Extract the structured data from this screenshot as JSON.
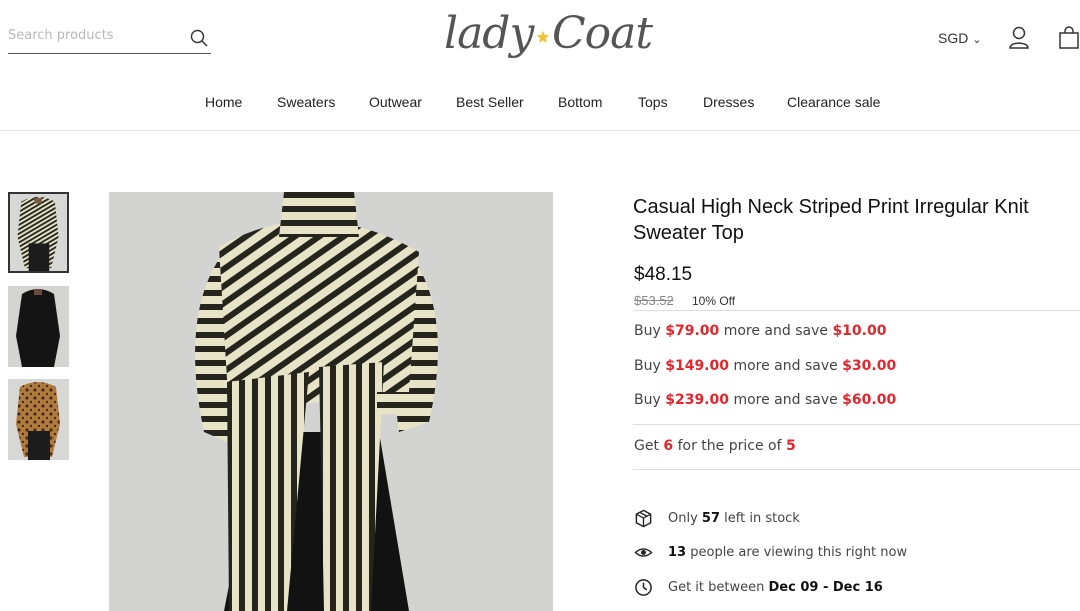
{
  "header": {
    "search": {
      "placeholder": "Search products",
      "value": ""
    },
    "logo": {
      "left": "lady",
      "right": "Coat"
    },
    "currency": "SGD",
    "icons": {
      "search": "search-icon",
      "account": "user-icon",
      "cart": "shopping-bag-icon"
    }
  },
  "nav": {
    "items": [
      "Home",
      "Sweaters",
      "Outwear",
      "Best Seller",
      "Bottom",
      "Tops",
      "Dresses",
      "Clearance sale"
    ]
  },
  "gallery": {
    "thumbnail_count": 3,
    "active_index": 0
  },
  "product": {
    "title": "Casual High Neck Striped Print Irregular Knit Sweater Top",
    "price": "$48.15",
    "compare_price": "$53.52",
    "discount": "10% Off",
    "promotions": [
      {
        "prefix": "Buy",
        "amount": "$79.00",
        "middle": "more and save",
        "save": "$10.00"
      },
      {
        "prefix": "Buy",
        "amount": "$149.00",
        "middle": "more and save",
        "save": "$30.00"
      },
      {
        "prefix": "Buy",
        "amount": "$239.00",
        "middle": "more and save",
        "save": "$60.00"
      }
    ],
    "bundle": {
      "prefix": "Get",
      "get": "6",
      "middle": "for the price of",
      "pay": "5"
    },
    "stock": {
      "prefix": "Only",
      "count": "57",
      "suffix": "left in stock"
    },
    "viewers": {
      "count": "13",
      "suffix": "people are viewing this right now"
    },
    "delivery": {
      "prefix": "Get it between",
      "start": "Dec 09",
      "sep": " - ",
      "end": "Dec 16"
    }
  },
  "colors": {
    "accent_red": "#e3262e",
    "logo_star": "#f2c335"
  }
}
